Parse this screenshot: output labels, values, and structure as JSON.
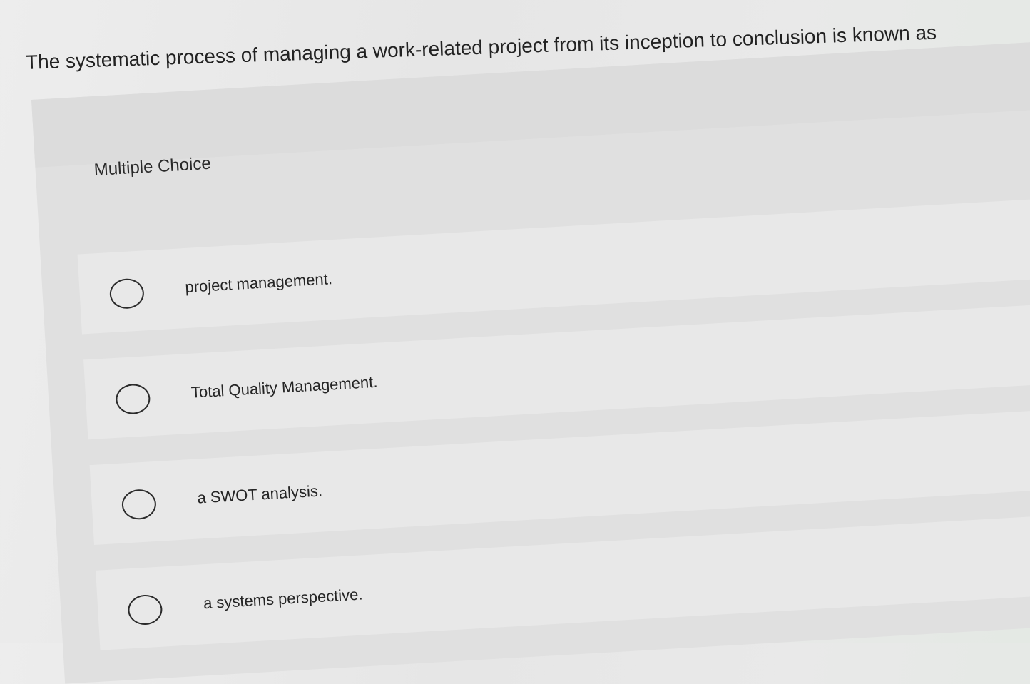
{
  "question": {
    "text": "The systematic process of managing a work-related project from its inception to conclusion is known as"
  },
  "quiz": {
    "type_label": "Multiple Choice",
    "options": [
      {
        "label": "project management.",
        "selected": false
      },
      {
        "label": "Total Quality Management.",
        "selected": false
      },
      {
        "label": "a SWOT analysis.",
        "selected": false
      },
      {
        "label": "a systems perspective.",
        "selected": false
      }
    ]
  },
  "icons": {
    "radio": "radio-unselected-icon"
  }
}
